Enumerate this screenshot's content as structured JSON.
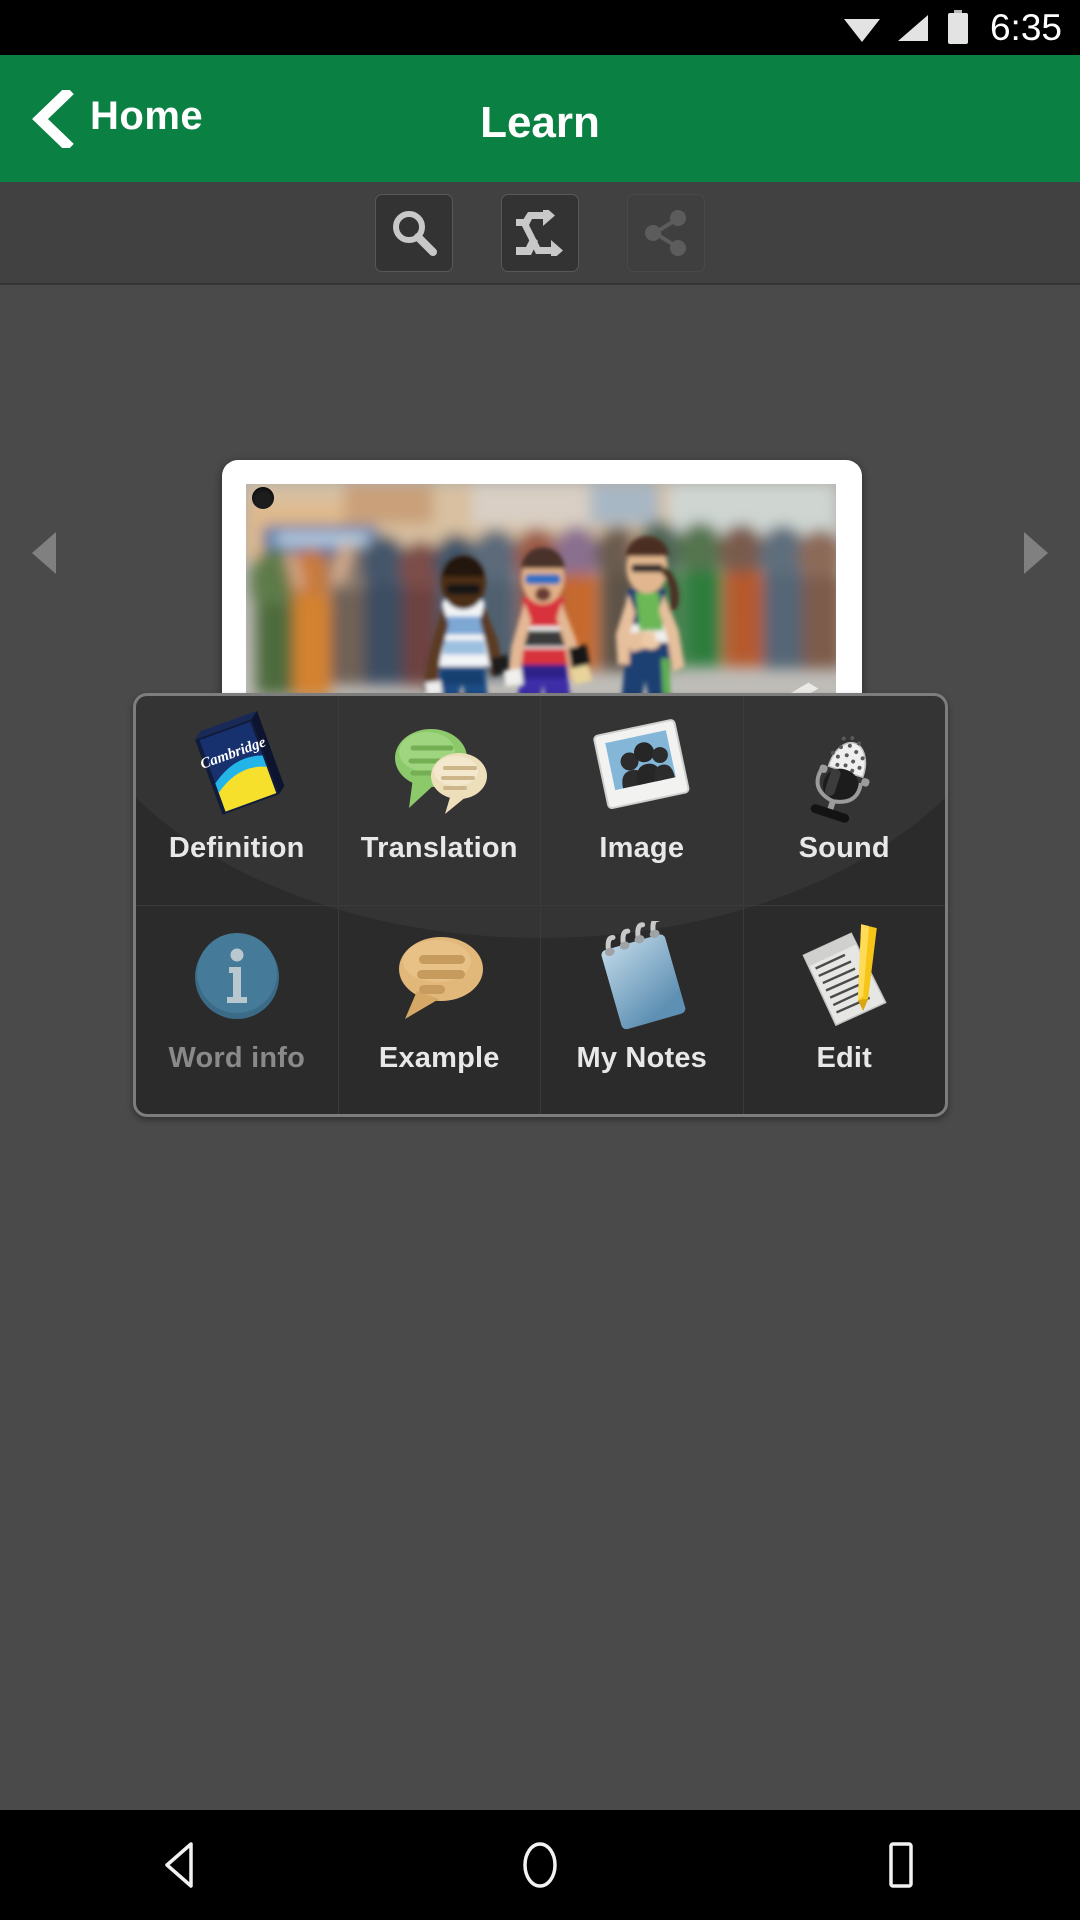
{
  "status_bar": {
    "time": "6:35",
    "icons": [
      "wifi-icon",
      "signal-icon",
      "battery-icon"
    ]
  },
  "app_bar": {
    "back_label": "Home",
    "title": "Learn",
    "back_icon": "chevron-left-icon",
    "accent_color": "#0b8043"
  },
  "action_toolbar": {
    "buttons": [
      {
        "name": "search",
        "icon": "search-icon",
        "enabled": true
      },
      {
        "name": "shuffle",
        "icon": "shuffle-icon",
        "enabled": true
      },
      {
        "name": "share",
        "icon": "share-icon",
        "enabled": false
      }
    ]
  },
  "carousel": {
    "prev_icon": "triangle-left-icon",
    "next_icon": "triangle-right-icon",
    "card": {
      "image_name": "marathon-runners-photo",
      "description": "Three female marathon runners racing on a street with a blurred crowd of spectators in the background",
      "pin_icon": "photo-pin-dot"
    }
  },
  "option_grid": {
    "rows": [
      [
        {
          "label": "Definition",
          "icon": "cambridge-dictionary-book-icon",
          "enabled": true
        },
        {
          "label": "Translation",
          "icon": "two-speech-bubbles-icon",
          "enabled": true
        },
        {
          "label": "Image",
          "icon": "photo-frame-icon",
          "enabled": true
        },
        {
          "label": "Sound",
          "icon": "microphone-icon",
          "enabled": true
        }
      ],
      [
        {
          "label": "Word info",
          "icon": "info-circle-icon",
          "enabled": false
        },
        {
          "label": "Example",
          "icon": "speech-bubble-icon",
          "enabled": true
        },
        {
          "label": "My Notes",
          "icon": "spiral-notepad-icon",
          "enabled": true
        },
        {
          "label": "Edit",
          "icon": "document-pencil-icon",
          "enabled": true
        }
      ]
    ]
  },
  "nav_bar": {
    "buttons": [
      {
        "name": "back",
        "icon": "nav-back-triangle-icon"
      },
      {
        "name": "home",
        "icon": "nav-home-circle-icon"
      },
      {
        "name": "recents",
        "icon": "nav-recents-square-icon"
      }
    ]
  }
}
